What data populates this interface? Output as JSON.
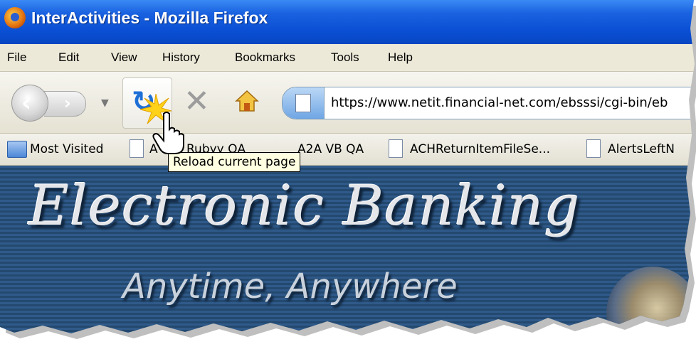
{
  "window": {
    "title": "InterActivities - Mozilla Firefox"
  },
  "menu": {
    "items": [
      "File",
      "Edit",
      "View",
      "History",
      "Bookmarks",
      "Tools",
      "Help"
    ]
  },
  "navigation": {
    "url": "https://www.netit.financial-net.com/ebsssi/cgi-bin/eb",
    "reload_tooltip": "Reload current page",
    "icons": [
      "back-arrow-icon",
      "forward-arrow-icon",
      "history-dropdown-icon",
      "reload-icon",
      "stop-icon",
      "home-icon",
      "site-identity-icon"
    ]
  },
  "bookmarks": {
    "items": [
      "Most Visited",
      "A",
      "Rubyy QA",
      "A2A VB QA",
      "ACHReturnItemFileSe...",
      "AlertsLeftN"
    ]
  },
  "banner": {
    "title": "Electronic Banking",
    "subtitle": "Anytime, Anywhere"
  },
  "colors": {
    "titlebar": "#0a4fd4",
    "reload": "#1d6fd6",
    "banner": "#2f5a8a",
    "tooltip_bg": "#ffffe1"
  }
}
